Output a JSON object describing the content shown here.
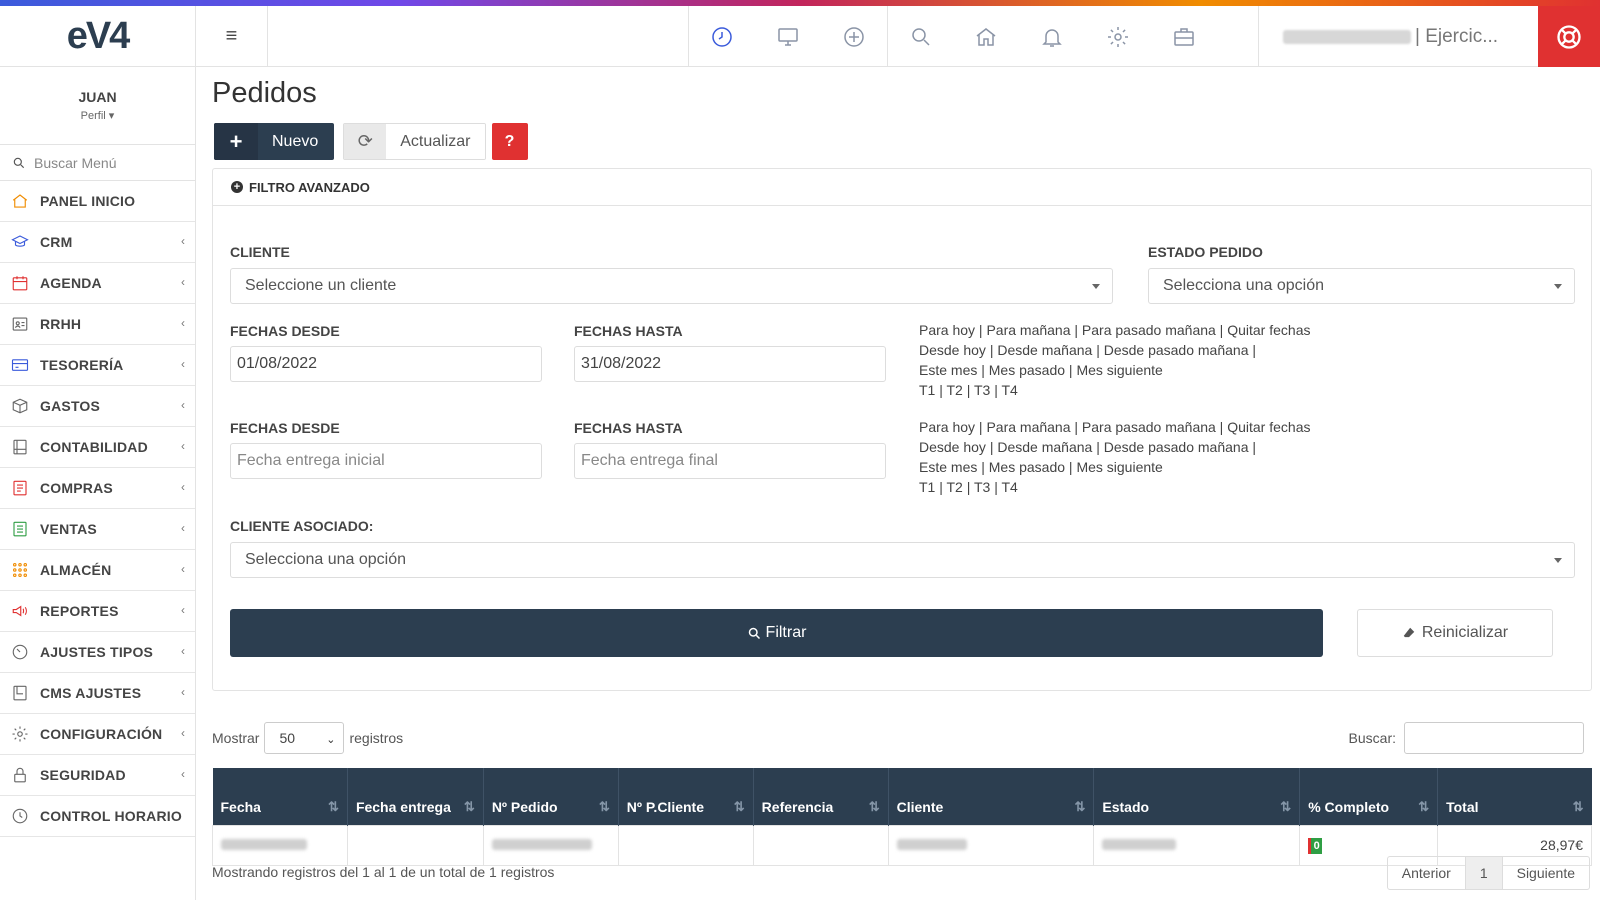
{
  "app": {
    "logo": "eV4",
    "menu_glyph": "≡",
    "user_suffix": "| Ejercic..."
  },
  "colors": {
    "primary": "#2c3e50",
    "danger": "#e03131",
    "accent": "#3b5bdb"
  },
  "top_icons": [
    "clock-icon",
    "monitor-icon",
    "plus-circle-icon",
    "search-icon",
    "home-icon",
    "bell-icon",
    "gear-icon",
    "briefcase-icon",
    "lifebuoy-icon"
  ],
  "sidebar": {
    "user_name": "JUAN",
    "profile_label": "Perfil",
    "search_placeholder": "Buscar Menú",
    "items": [
      {
        "label": "PANEL INICIO",
        "icon": "home-icon",
        "color": "#f08c00",
        "chevron": false
      },
      {
        "label": "CRM",
        "icon": "graduation-cap-icon",
        "color": "#3b5bdb",
        "chevron": true
      },
      {
        "label": "AGENDA",
        "icon": "calendar-icon",
        "color": "#e03131",
        "chevron": true
      },
      {
        "label": "RRHH",
        "icon": "id-card-icon",
        "color": "#666666",
        "chevron": true
      },
      {
        "label": "TESORERÍA",
        "icon": "credit-card-icon",
        "color": "#3b5bdb",
        "chevron": true
      },
      {
        "label": "GASTOS",
        "icon": "box-icon",
        "color": "#666666",
        "chevron": true
      },
      {
        "label": "CONTABILIDAD",
        "icon": "ledger-icon",
        "color": "#666666",
        "chevron": true
      },
      {
        "label": "COMPRAS",
        "icon": "purchases-icon",
        "color": "#e03131",
        "chevron": true
      },
      {
        "label": "VENTAS",
        "icon": "sales-icon",
        "color": "#2f9e44",
        "chevron": true
      },
      {
        "label": "ALMACÉN",
        "icon": "grid-dots-icon",
        "color": "#f08c00",
        "chevron": true
      },
      {
        "label": "REPORTES",
        "icon": "megaphone-icon",
        "color": "#e03131",
        "chevron": true
      },
      {
        "label": "AJUSTES TIPOS",
        "icon": "dial-icon",
        "color": "#666666",
        "chevron": true
      },
      {
        "label": "CMS AJUSTES",
        "icon": "page-icon",
        "color": "#666666",
        "chevron": true
      },
      {
        "label": "CONFIGURACIÓN",
        "icon": "gear-icon",
        "color": "#666666",
        "chevron": true
      },
      {
        "label": "SEGURIDAD",
        "icon": "lock-icon",
        "color": "#666666",
        "chevron": true
      },
      {
        "label": "CONTROL HORARIO",
        "icon": "clock-icon",
        "color": "#666666",
        "chevron": false
      }
    ]
  },
  "page": {
    "title": "Pedidos",
    "new_label": "Nuevo",
    "update_label": "Actualizar",
    "help_label": "?"
  },
  "filter": {
    "header": "FILTRO AVANZADO",
    "cliente_label": "CLIENTE",
    "cliente_placeholder": "Seleccione un cliente",
    "estado_label": "ESTADO PEDIDO",
    "estado_placeholder": "Selecciona una opción",
    "fechas_desde_label": "FECHAS DESDE",
    "fechas_hasta_label": "FECHAS HASTA",
    "fecha_desde_value": "01/08/2022",
    "fecha_hasta_value": "31/08/2022",
    "entrega_desde_label": "FECHAS DESDE",
    "entrega_hasta_label": "FECHAS HASTA",
    "entrega_desde_placeholder": "Fecha entrega inicial",
    "entrega_hasta_placeholder": "Fecha entrega final",
    "shortcuts": [
      "Para hoy | Para mañana | Para pasado mañana | Quitar fechas",
      "Desde hoy | Desde mañana | Desde pasado mañana |",
      "Este mes | Mes pasado | Mes siguiente",
      "T1 | T2 | T3 | T4"
    ],
    "cliente_asociado_label": "CLIENTE ASOCIADO:",
    "cliente_asociado_placeholder": "Selecciona una opción",
    "filtrar_label": "Filtrar",
    "reset_label": "Reinicializar"
  },
  "table": {
    "show_label": "Mostrar",
    "page_size": "50",
    "records_label": "registros",
    "search_label": "Buscar:",
    "columns": [
      "Fecha",
      "Fecha entrega",
      "Nº Pedido",
      "Nº P.Cliente",
      "Referencia",
      "Cliente",
      "Estado",
      "% Completo",
      "Total"
    ],
    "rows": [
      {
        "pct_badge": "0",
        "total": "28,97€"
      }
    ],
    "footer": "Mostrando registros del 1 al 1 de un total de 1 registros",
    "prev_label": "Anterior",
    "current_page": "1",
    "next_label": "Siguiente"
  }
}
